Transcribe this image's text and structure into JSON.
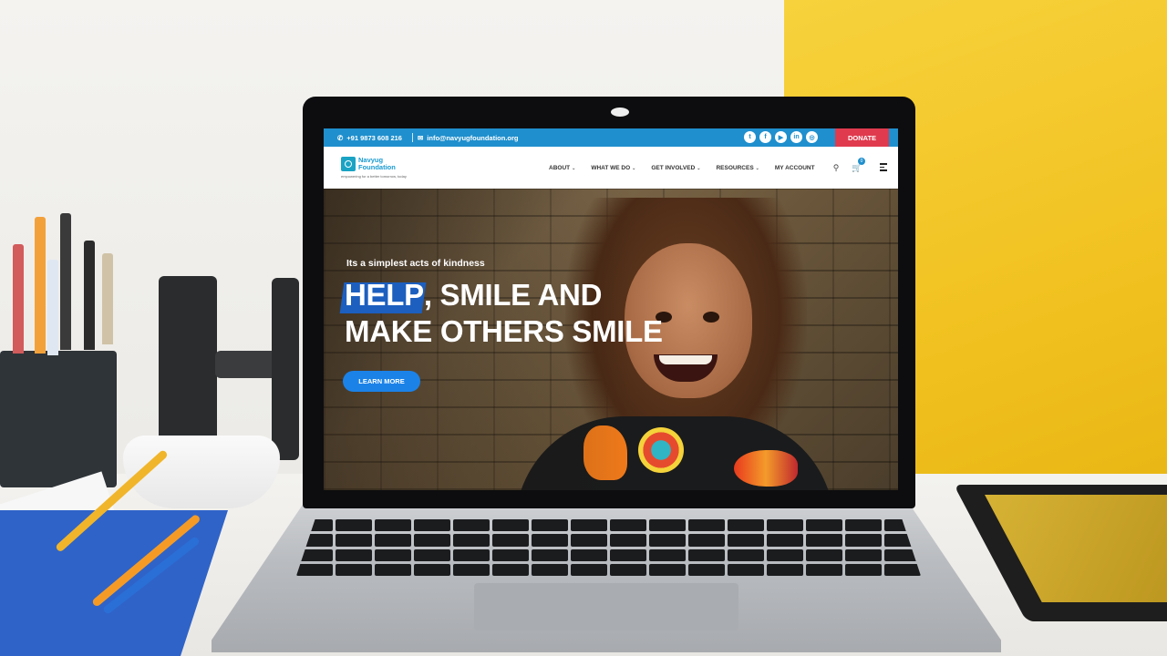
{
  "topbar": {
    "phone": "+91 9873 608 216",
    "email": "info@navyugfoundation.org",
    "social": [
      {
        "icon": "twitter-icon",
        "glyph": "t"
      },
      {
        "icon": "facebook-icon",
        "glyph": "f"
      },
      {
        "icon": "youtube-icon",
        "glyph": "▶"
      },
      {
        "icon": "linkedin-icon",
        "glyph": "in"
      },
      {
        "icon": "instagram-icon",
        "glyph": "◎"
      }
    ],
    "donate_label": "DONATE"
  },
  "nav": {
    "logo_name": "Navyug Foundation",
    "logo_tagline": "empowering for a better tomorrow, today",
    "menu": [
      {
        "label": "ABOUT",
        "has_dropdown": true
      },
      {
        "label": "WHAT WE DO",
        "has_dropdown": true
      },
      {
        "label": "GET INVOLVED",
        "has_dropdown": true
      },
      {
        "label": "RESOURCES",
        "has_dropdown": true
      },
      {
        "label": "MY ACCOUNT",
        "has_dropdown": false
      }
    ],
    "cart_count": "0"
  },
  "hero": {
    "subtitle": "Its a simplest acts of kindness",
    "title_highlight": "HELP",
    "title_line1_rest": ", SMILE AND",
    "title_line2": "MAKE OTHERS SMILE",
    "cta_label": "LEARN MORE"
  },
  "colors": {
    "topbar": "#1f8fcd",
    "donate": "#e03a4e",
    "highlight": "#1c5fbf",
    "cta": "#1b82e8",
    "wall_accent": "#f1c221"
  }
}
